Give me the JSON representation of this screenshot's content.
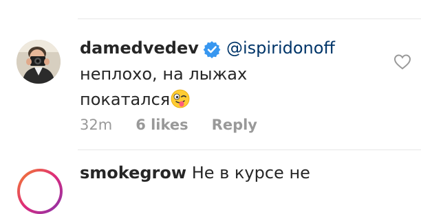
{
  "previous_comment": {
    "time_label": "",
    "likes_label": "",
    "reply_label": ""
  },
  "comment": {
    "username": "damedvedev",
    "mention": "@ispiridonoff",
    "text_line1": "неплохо, на лыжах",
    "text_line2": "покатался",
    "emoji": "winking-face-with-tongue",
    "time": "32m",
    "likes": "6 likes",
    "reply_label": "Reply"
  },
  "next_comment": {
    "username": "smokegrow",
    "text": "Не в курсе не"
  },
  "colors": {
    "username": "#262626",
    "mention": "#003569",
    "meta": "#999999",
    "verified": "#3897f0",
    "divider": "#e6e6e6"
  }
}
